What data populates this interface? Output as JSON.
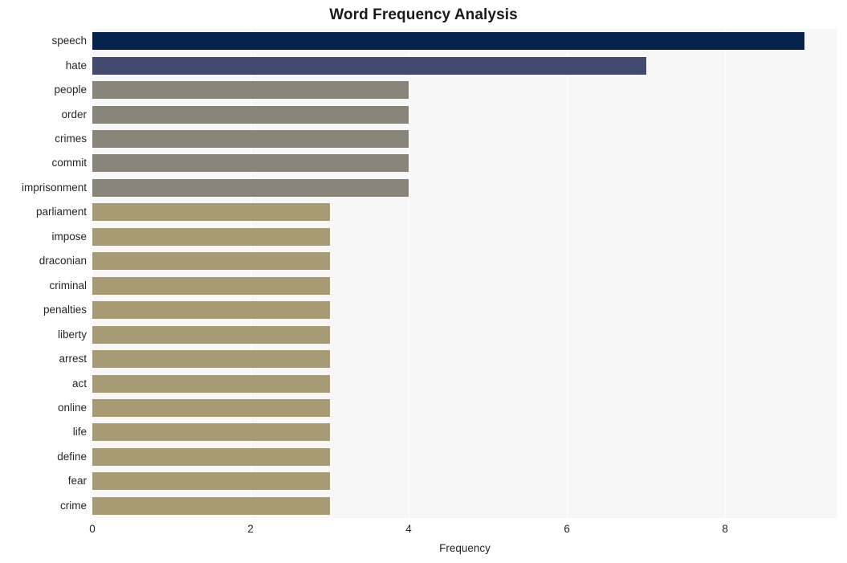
{
  "chart_data": {
    "type": "bar",
    "orientation": "horizontal",
    "title": "Word Frequency Analysis",
    "xlabel": "Frequency",
    "ylabel": "",
    "categories": [
      "speech",
      "hate",
      "people",
      "order",
      "crimes",
      "commit",
      "imprisonment",
      "parliament",
      "impose",
      "draconian",
      "criminal",
      "penalties",
      "liberty",
      "arrest",
      "act",
      "online",
      "life",
      "define",
      "fear",
      "crime"
    ],
    "values": [
      9,
      7,
      4,
      4,
      4,
      4,
      4,
      3,
      3,
      3,
      3,
      3,
      3,
      3,
      3,
      3,
      3,
      3,
      3,
      3
    ],
    "bar_colors": [
      "#04234c",
      "#3f4a6e",
      "#8a8579",
      "#8a8579",
      "#8a8579",
      "#8a8579",
      "#8a8579",
      "#a69b72",
      "#a69b72",
      "#a69b72",
      "#a69b72",
      "#a69b72",
      "#a69b72",
      "#a69b72",
      "#a69b72",
      "#a69b72",
      "#a69b72",
      "#a69b72",
      "#a69b72",
      "#a69b72"
    ],
    "xlim": [
      0,
      9.42
    ],
    "xticks": [
      0,
      2,
      4,
      6,
      8
    ],
    "xtick_labels": [
      "0",
      "2",
      "4",
      "6",
      "8"
    ],
    "grid": true,
    "grid_axis": "x",
    "grid_color": "#ffffff",
    "plot_background": "#f7f7f7",
    "figure_background": "#ffffff",
    "legend": false
  }
}
